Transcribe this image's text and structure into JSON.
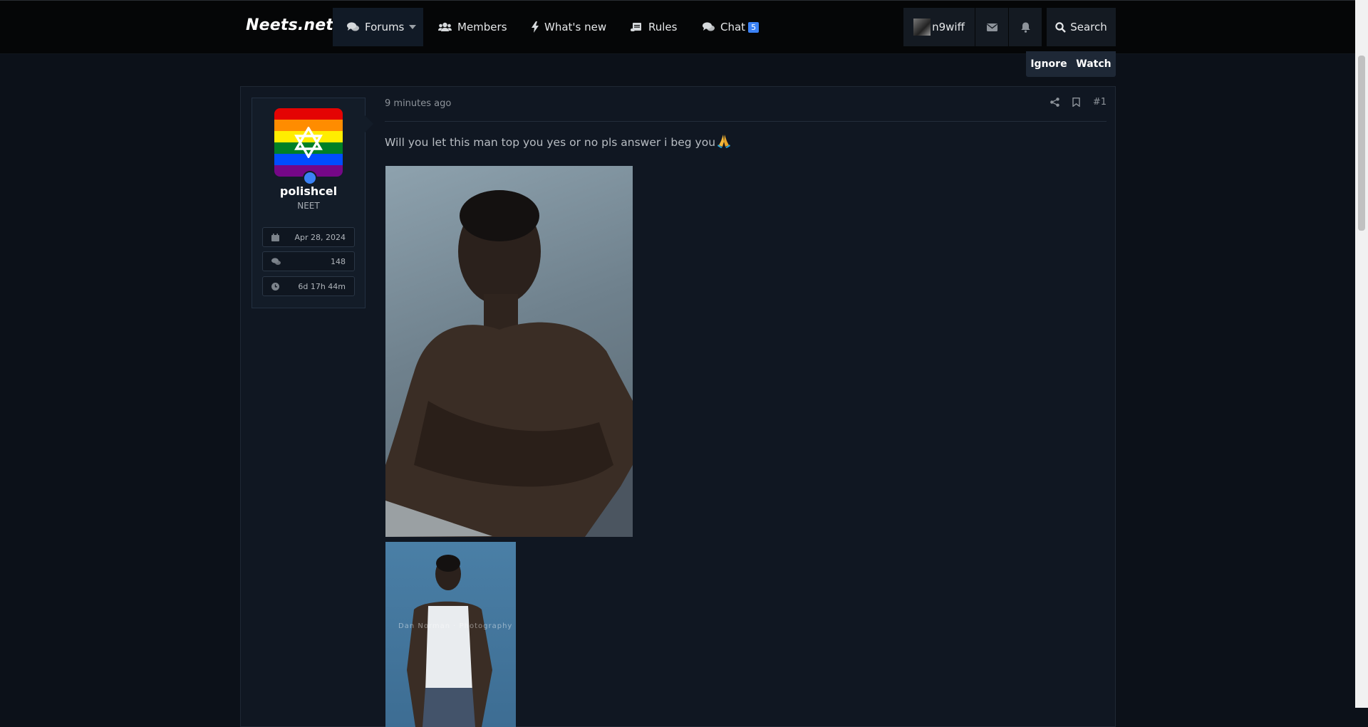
{
  "site": {
    "name": "Neets.net"
  },
  "nav": {
    "forums": "Forums",
    "members": "Members",
    "whats_new": "What's new",
    "rules": "Rules",
    "chat": "Chat",
    "chat_badge": "5"
  },
  "account": {
    "username": "n9wiff",
    "search": "Search"
  },
  "thread_actions": {
    "ignore": "Ignore",
    "watch": "Watch"
  },
  "post": {
    "author": "polishcel",
    "user_title": "NEET",
    "joined": "Apr 28, 2024",
    "messages": "148",
    "online_time": "6d 17h 44m",
    "time": "9 minutes ago",
    "number": "#1",
    "text": "Will you let this man top you yes or no pls answer i beg you",
    "image2_watermark": "Dan Norman · Photography"
  },
  "colors": {
    "background": "#0c1119",
    "accent": "#3b82f6",
    "pride": [
      "#e40303",
      "#ff8c00",
      "#ffed00",
      "#008026",
      "#004dff",
      "#750787"
    ]
  }
}
